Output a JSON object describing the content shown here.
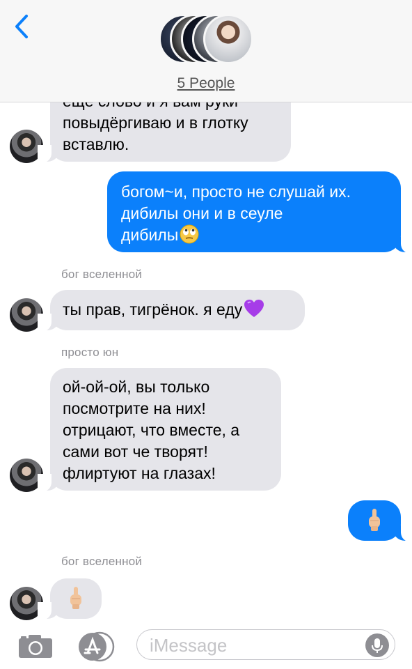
{
  "header": {
    "people_label": "5 People"
  },
  "messages": [
    {
      "direction": "incoming",
      "sender": "",
      "text": "ещё слово и я вам руки\nповыдёргиваю и в глотку\nвставлю."
    },
    {
      "direction": "outgoing",
      "text": "богом~и, просто не слушай их.\nдибилы они и в сеуле\nдибилы",
      "emoji": "eye-roll-emoji"
    },
    {
      "direction": "incoming",
      "sender": "бог вселенной",
      "text": "ты прав, тигрёнок. я еду",
      "emoji": "purple-heart-emoji"
    },
    {
      "direction": "incoming",
      "sender": "просто юн",
      "text": "ой-ой-ой, вы только\nпосмотрите на них!\nотрицают, что вместе, а\nсами вот че творят!\nфлиртуют на глазах!"
    },
    {
      "direction": "outgoing",
      "text": "",
      "emoji": "middle-finger-emoji"
    },
    {
      "direction": "incoming",
      "sender": "бог вселенной",
      "text": "",
      "emoji": "middle-finger-emoji"
    }
  ],
  "input": {
    "placeholder": "iMessage"
  },
  "icons": {
    "back": "chevron-left-icon",
    "camera": "camera-icon",
    "apps": "app-store-icon",
    "mic": "microphone-icon"
  },
  "colors": {
    "accent": "#0b80fb",
    "incoming_bubble": "#e5e5ea",
    "header_bg": "#f7f7f7",
    "secondary_text": "#8e8e93"
  }
}
